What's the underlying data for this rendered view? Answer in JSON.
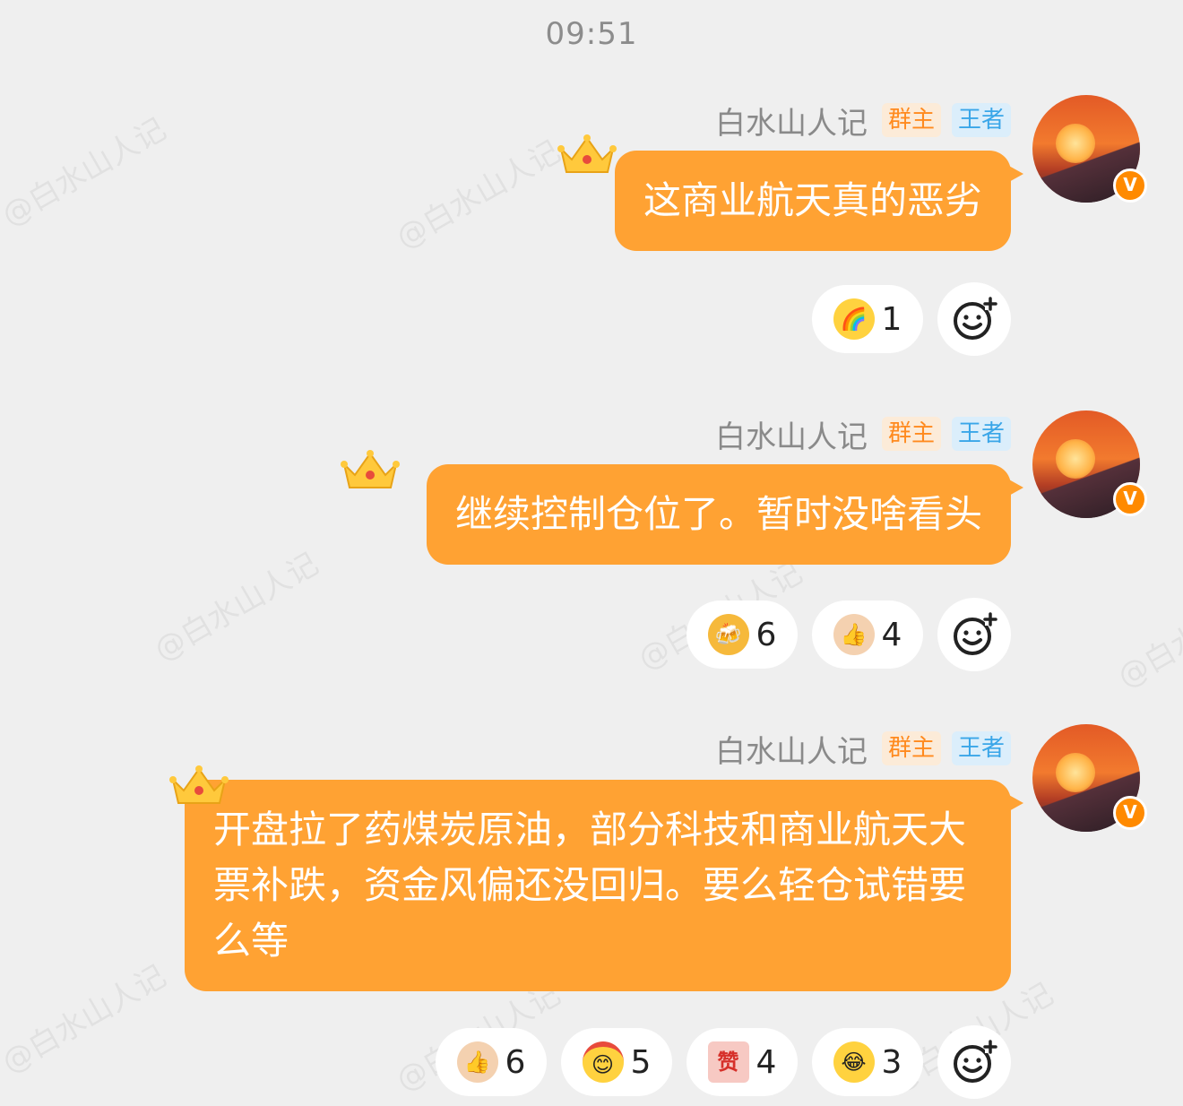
{
  "time": "09:51",
  "watermark": "@白水山人记",
  "sender": {
    "name": "白水山人记",
    "badge_owner": "群主",
    "badge_rank": "王者",
    "verified_mark": "V"
  },
  "colors": {
    "bubble": "#ffa233",
    "background": "#efefef",
    "owner_badge": "#ff8a1e",
    "rank_badge": "#3aa6e8"
  },
  "messages": [
    {
      "text": "这商业航天真的恶劣",
      "reactions": [
        {
          "icon": "rainbow-vomit-emoji",
          "count": "1"
        }
      ]
    },
    {
      "text": "继续控制仓位了。暂时没啥看头",
      "reactions": [
        {
          "icon": "beer-cheers-emoji",
          "count": "6"
        },
        {
          "icon": "thumbs-up-emoji",
          "count": "4"
        }
      ]
    },
    {
      "text": "开盘拉了药煤炭原油，部分科技和商业航天大票补跌，资金风偏还没回归。要么轻仓试错要么等",
      "reactions": [
        {
          "icon": "thumbs-up-emoji",
          "count": "6"
        },
        {
          "icon": "cheer-headband-emoji",
          "count": "5"
        },
        {
          "icon": "zan-emoji",
          "count": "4",
          "label": "赞"
        },
        {
          "icon": "laugh-cry-emoji",
          "count": "3"
        }
      ]
    }
  ]
}
